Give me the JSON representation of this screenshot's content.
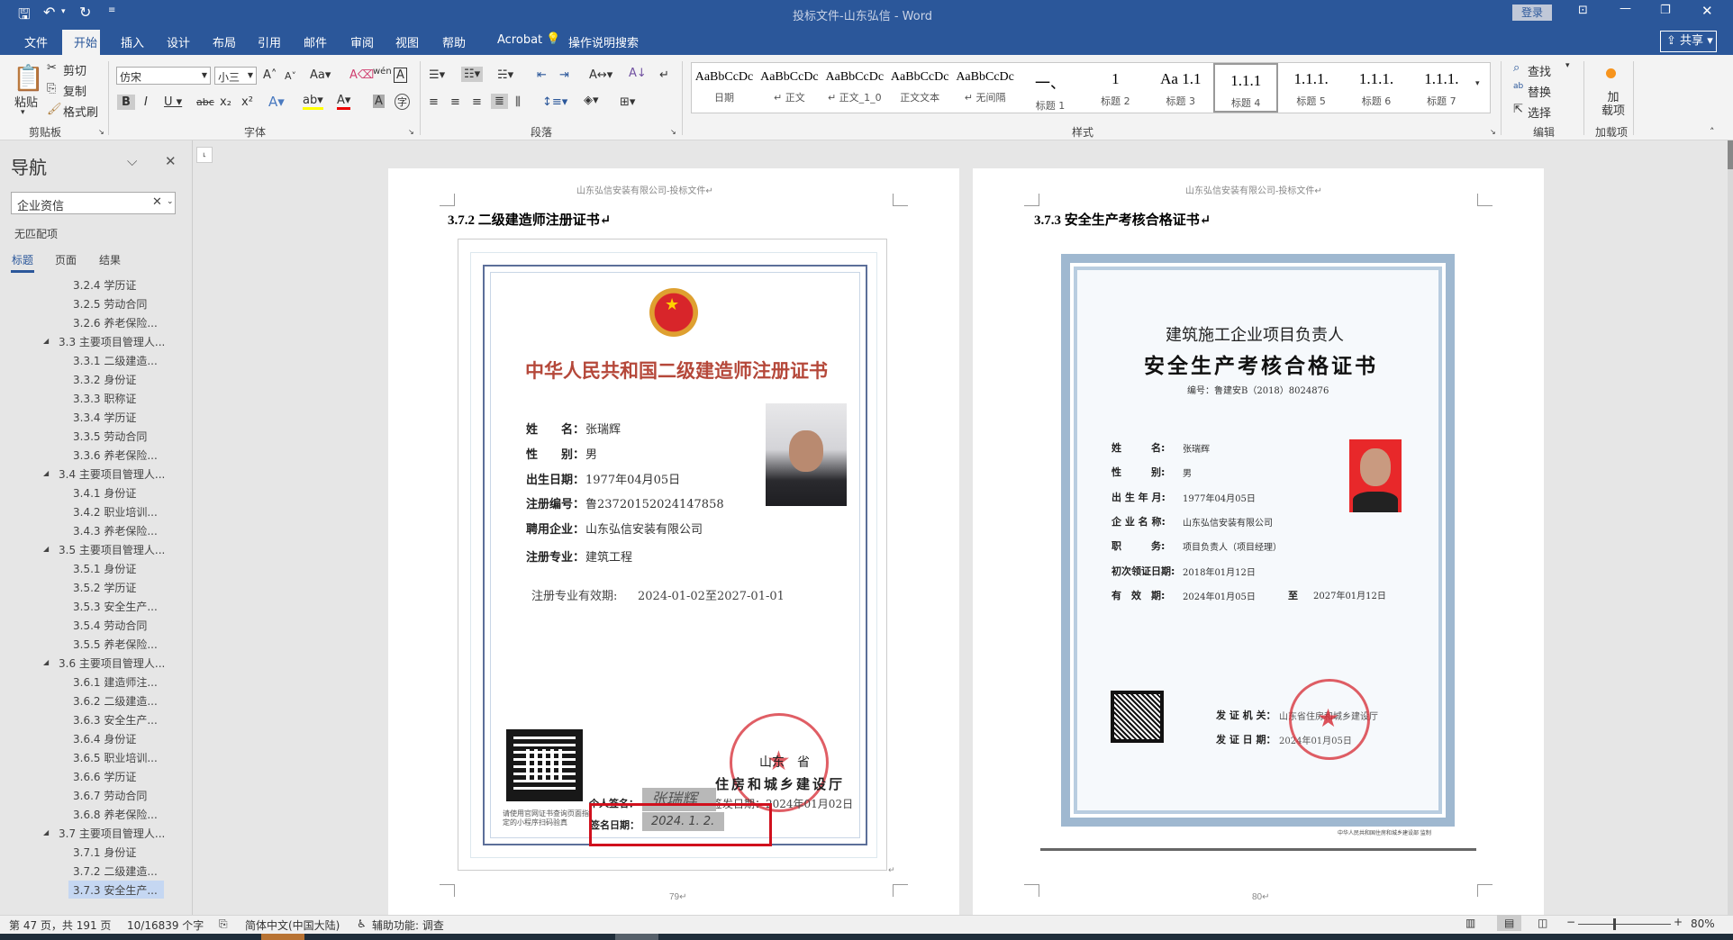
{
  "window": {
    "title": "投标文件-山东弘信  -  Word",
    "login": "登录",
    "share": "共享"
  },
  "qat": {
    "save": "save-icon",
    "undo": "undo-icon",
    "redo": "redo-icon"
  },
  "tabs": [
    "文件",
    "开始",
    "插入",
    "设计",
    "布局",
    "引用",
    "邮件",
    "审阅",
    "视图",
    "帮助",
    "Acrobat"
  ],
  "tell_me": "操作说明搜索",
  "ribbon": {
    "clipboard": {
      "label": "剪贴板",
      "paste": "粘贴",
      "cut": "剪切",
      "copy": "复制",
      "format_painter": "格式刷"
    },
    "font": {
      "label": "字体",
      "font_name": "仿宋",
      "font_size": "小三"
    },
    "paragraph": {
      "label": "段落"
    },
    "styles": {
      "label": "样式",
      "items": [
        {
          "preview": "AaBbCcDc",
          "name": "日期"
        },
        {
          "preview": "AaBbCcDc",
          "name": "↵ 正文"
        },
        {
          "preview": "AaBbCcDc",
          "name": "↵ 正文_1_0"
        },
        {
          "preview": "AaBbCcDc",
          "name": "正文文本"
        },
        {
          "preview": "AaBbCcDc",
          "name": "↵ 无间隔"
        },
        {
          "preview": "一、",
          "name": "标题 1"
        },
        {
          "preview": "1",
          "name": "标题 2"
        },
        {
          "preview": "Aa 1.1",
          "name": "标题 3"
        },
        {
          "preview": "1.1.1",
          "name": "标题 4"
        },
        {
          "preview": "1.1.1.",
          "name": "标题 5"
        },
        {
          "preview": "1.1.1.",
          "name": "标题 6"
        },
        {
          "preview": "1.1.1.",
          "name": "标题 7"
        }
      ],
      "selected": "标题 4"
    },
    "editing": {
      "label": "编辑",
      "find": "查找",
      "replace": "替换",
      "select": "选择"
    },
    "addins": {
      "label": "加载项",
      "button": "加\n载项"
    }
  },
  "nav": {
    "title": "导航",
    "search_value": "企业资信",
    "no_match": "无匹配项",
    "tabs": [
      "标题",
      "页面",
      "结果"
    ],
    "active_tab": "标题",
    "items": [
      {
        "t": "3.2.4 学历证",
        "lvl": 3
      },
      {
        "t": "3.2.5 劳动合同",
        "lvl": 3
      },
      {
        "t": "3.2.6 养老保险...",
        "lvl": 3
      },
      {
        "t": "3.3 主要项目管理人...",
        "lvl": 2
      },
      {
        "t": "3.3.1 二级建造...",
        "lvl": 3
      },
      {
        "t": "3.3.2 身份证",
        "lvl": 3
      },
      {
        "t": "3.3.3 职称证",
        "lvl": 3
      },
      {
        "t": "3.3.4 学历证",
        "lvl": 3
      },
      {
        "t": "3.3.5 劳动合同",
        "lvl": 3
      },
      {
        "t": "3.3.6 养老保险...",
        "lvl": 3
      },
      {
        "t": "3.4 主要项目管理人...",
        "lvl": 2
      },
      {
        "t": "3.4.1 身份证",
        "lvl": 3
      },
      {
        "t": "3.4.2 职业培训...",
        "lvl": 3
      },
      {
        "t": "3.4.3 养老保险...",
        "lvl": 3
      },
      {
        "t": "3.5 主要项目管理人...",
        "lvl": 2
      },
      {
        "t": "3.5.1 身份证",
        "lvl": 3
      },
      {
        "t": "3.5.2 学历证",
        "lvl": 3
      },
      {
        "t": "3.5.3 安全生产...",
        "lvl": 3
      },
      {
        "t": "3.5.4 劳动合同",
        "lvl": 3
      },
      {
        "t": "3.5.5 养老保险...",
        "lvl": 3
      },
      {
        "t": "3.6 主要项目管理人...",
        "lvl": 2
      },
      {
        "t": "3.6.1 建造师注...",
        "lvl": 3
      },
      {
        "t": "3.6.2 二级建造...",
        "lvl": 3
      },
      {
        "t": "3.6.3 安全生产...",
        "lvl": 3
      },
      {
        "t": "3.6.4 身份证",
        "lvl": 3
      },
      {
        "t": "3.6.5 职业培训...",
        "lvl": 3
      },
      {
        "t": "3.6.6 学历证",
        "lvl": 3
      },
      {
        "t": "3.6.7 劳动合同",
        "lvl": 3
      },
      {
        "t": "3.6.8 养老保险...",
        "lvl": 3
      },
      {
        "t": "3.7 主要项目管理人...",
        "lvl": 2
      },
      {
        "t": "3.7.1 身份证",
        "lvl": 3
      },
      {
        "t": "3.7.2 二级建造...",
        "lvl": 3
      },
      {
        "t": "3.7.3 安全生产...",
        "lvl": 3,
        "selected": true
      }
    ]
  },
  "page1": {
    "header": "山东弘信安装有限公司-投标文件↵",
    "heading": "3.7.2 二级建造师注册证书↵",
    "cert": {
      "title": "中华人民共和国二级建造师注册证书",
      "fields": [
        {
          "label": "姓　　名：",
          "value": "张瑞辉"
        },
        {
          "label": "性　　别：",
          "value": "男"
        },
        {
          "label": "出生日期：",
          "value": "1977年04月05日"
        },
        {
          "label": "注册编号：",
          "value": "鲁2372015202414785​8"
        },
        {
          "label": "聘用企业：",
          "value": "山东弘信安装有限公司"
        },
        {
          "label": "注册专业：",
          "value": "建筑工程"
        }
      ],
      "validity_label": "注册专业有效期:",
      "validity_value": "2024-01-02至2027-01-01",
      "qr_caption_1": "请使用官网证书查询页面指",
      "qr_caption_2": "定的小程序扫码验真",
      "issuer_1": "山东　省",
      "issuer_2": "住房和城乡建设厅",
      "issue_date": "签发日期：2024年01月02日",
      "sign_label": "个人签名：",
      "sign_value": "张瑞辉",
      "sign_date_label": "签名日期：",
      "sign_date_value": "2024. 1. 2."
    },
    "highlight_color": "#d0101d",
    "page_number": "79↵"
  },
  "page2": {
    "header": "山东弘信安装有限公司-投标文件↵",
    "heading": "3.7.3 安全生产考核合格证书↵",
    "cert": {
      "title_1": "建筑施工企业项目负责人",
      "title_2": "安全生产考核合格证书",
      "number": "编号：鲁建安B（2018）8024876",
      "fields": [
        {
          "label": "姓　　　名:",
          "value": "张瑞辉"
        },
        {
          "label": "性　　　别:",
          "value": "男"
        },
        {
          "label": "出 生 年 月:",
          "value": "1977年04月05日"
        },
        {
          "label": "企 业 名 称:",
          "value": "山东弘信安装有限公司"
        },
        {
          "label": "职　　　务:",
          "value": "项目负责人（项目经理）"
        },
        {
          "label": "初次领证日期:",
          "value": "2018年01月12日"
        },
        {
          "label": "有　效　期:",
          "value": "2024年01月05日"
        }
      ],
      "valid_to_label": "至",
      "valid_to_value": "2027年01月12日",
      "issuer_label": "发 证 机 关：",
      "issuer_value": "山东省住房和城乡建设厅",
      "issue_date_label": "发 证 日 期：",
      "issue_date_value": "2024年01月05日",
      "footer": "中华人民共和国住房和城乡建设部 监制"
    },
    "page_number": "80↵"
  },
  "status": {
    "page": "第 47 页，共 191 页",
    "words": "10/16839 个字",
    "language": "简体中文(中国大陆)",
    "accessibility": "辅助功能: 调查",
    "zoom": "80%",
    "zoom_percent": 80
  },
  "colors": {
    "brand": "#2b579a",
    "cert_title": "#b5483a",
    "stamp": "#d62832"
  }
}
